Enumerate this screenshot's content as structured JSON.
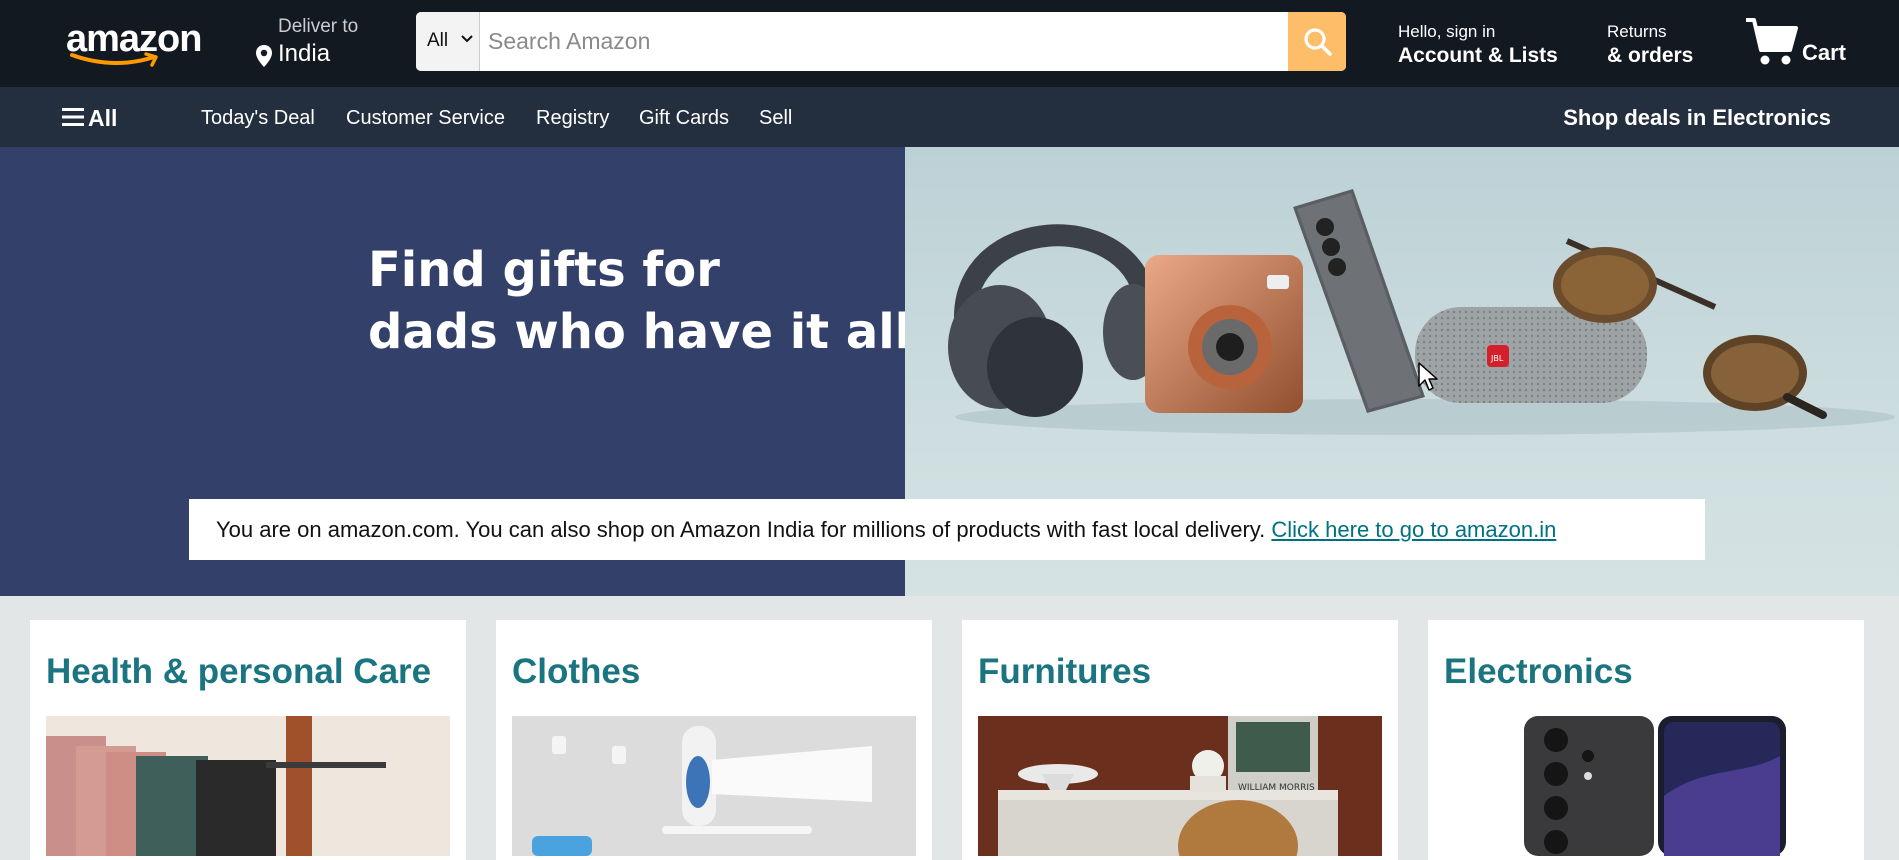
{
  "header": {
    "logo_text": "amazon",
    "deliver_line1": "Deliver to",
    "deliver_line2": "India",
    "search": {
      "category": "All",
      "placeholder": "Search Amazon",
      "value": ""
    },
    "account_line1": "Hello, sign in",
    "account_line2": "Account & Lists",
    "returns_line1": "Returns",
    "returns_line2": "& orders",
    "cart_label": "Cart"
  },
  "subnav": {
    "all_label": "All",
    "items": [
      {
        "label": "Today's Deal"
      },
      {
        "label": "Customer Service"
      },
      {
        "label": "Registry"
      },
      {
        "label": "Gift Cards"
      },
      {
        "label": "Sell"
      }
    ],
    "right_label": "Shop deals in Electronics"
  },
  "hero": {
    "title_line1": "Find gifts for",
    "title_line2": "dads who have it all"
  },
  "notice": {
    "text": "You are on amazon.com. You can also shop on Amazon India for millions of products with fast local delivery. ",
    "link": "Click here to go to amazon.in"
  },
  "cards": [
    {
      "title": "Health & personal Care"
    },
    {
      "title": "Clothes"
    },
    {
      "title": "Furnitures"
    },
    {
      "title": "Electronics"
    }
  ],
  "colors": {
    "nav_dark": "#131921",
    "subnav": "#232f3e",
    "search_button": "#febd69",
    "hero_left": "#33406a",
    "link": "#007185",
    "card_title": "#1a7580",
    "logo_smile": "#ff9900"
  },
  "icons": {
    "location": "location-pin-icon",
    "search": "search-icon",
    "cart": "cart-icon",
    "menu": "hamburger-menu-icon",
    "dropdown": "chevron-down-icon"
  }
}
